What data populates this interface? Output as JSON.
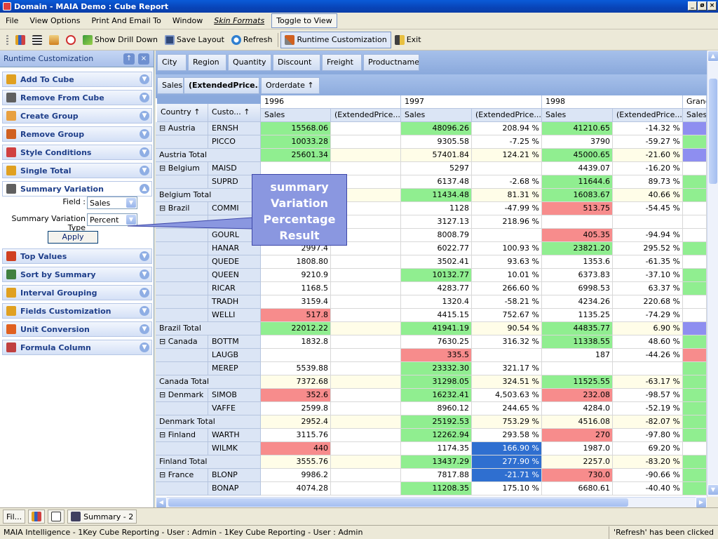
{
  "window": {
    "title": "Domain - MAIA Demo : Cube Report",
    "buttons": [
      "_",
      "ø",
      "×"
    ]
  },
  "menu": {
    "items": [
      "File",
      "View Options",
      "Print And Email To",
      "Window",
      "Skin Formats",
      "Toggle to View"
    ]
  },
  "toolbar": {
    "show_drill_down": "Show Drill Down",
    "save_layout": "Save Layout",
    "refresh": "Refresh",
    "runtime_customization": "Runtime Customization",
    "exit": "Exit"
  },
  "leftpanel": {
    "title": "Runtime Customization",
    "pin": "↑",
    "close": "×",
    "sections": [
      {
        "label": "Add To Cube",
        "icon": "add-cube-icon",
        "color": "#e0a020"
      },
      {
        "label": "Remove From Cube",
        "icon": "remove-cube-icon",
        "color": "#606060"
      },
      {
        "label": "Create Group",
        "icon": "create-group-icon",
        "color": "#e8a040"
      },
      {
        "label": "Remove Group",
        "icon": "remove-group-icon",
        "color": "#d06020"
      },
      {
        "label": "Style Conditions",
        "icon": "style-conditions-icon",
        "color": "#d04040"
      },
      {
        "label": "Single Total",
        "icon": "single-total-icon",
        "color": "#e0a020"
      },
      {
        "label": "Summary Variation",
        "icon": "summary-variation-icon",
        "color": "#606060"
      }
    ],
    "sections_after": [
      {
        "label": "Top Values",
        "icon": "top-values-icon",
        "color": "#d04020"
      },
      {
        "label": "Sort by Summary",
        "icon": "sort-summary-icon",
        "color": "#408040"
      },
      {
        "label": "Interval Grouping",
        "icon": "interval-grouping-icon",
        "color": "#e0a020"
      },
      {
        "label": "Fields Customization",
        "icon": "fields-customization-icon",
        "color": "#e0a020"
      },
      {
        "label": "Unit Conversion",
        "icon": "unit-conversion-icon",
        "color": "#e06020"
      },
      {
        "label": "Formula Column",
        "icon": "formula-column-icon",
        "color": "#c04040"
      }
    ],
    "summary_variation": {
      "field_label": "Field :",
      "field_value": "Sales",
      "type_label": "Summary Variation Type",
      "type_value": "Percent",
      "apply": "Apply"
    }
  },
  "grid": {
    "filter_fields": [
      "City",
      "Region",
      "Quantity",
      "Discount",
      "Freight",
      "Productname"
    ],
    "data_fields": [
      "Sales",
      "(ExtendedPrice..."
    ],
    "column_field": "Orderdate ↑",
    "years": [
      "1996",
      "1997",
      "1998",
      "Grand"
    ],
    "measures": [
      "Sales",
      "(ExtendedPrice...",
      "Sales",
      "(ExtendedPrice...",
      "Sales",
      "(ExtendedPrice...",
      "Sales"
    ],
    "row_fields": [
      "Country ↑",
      "Custo... ↑"
    ],
    "rows": [
      {
        "country": "⊟ Austria",
        "customer": "ERNSH",
        "v": [
          "15568.06",
          "",
          "48096.26",
          "208.94 %",
          "41210.65",
          "-14.32 %"
        ],
        "c": [
          "g",
          "",
          "g",
          "",
          "g",
          ""
        ],
        "gt": "p"
      },
      {
        "country": "",
        "customer": "PICCO",
        "v": [
          "10033.28",
          "",
          "9305.58",
          "-7.25 %",
          "3790",
          "-59.27 %"
        ],
        "c": [
          "g",
          "",
          "",
          "",
          "",
          ""
        ],
        "gt": "g"
      },
      {
        "total": "Austria Total",
        "v": [
          "25601.34",
          "",
          "57401.84",
          "124.21 %",
          "45000.65",
          "-21.60 %"
        ],
        "c": [
          "g",
          "",
          "",
          "",
          "g",
          ""
        ],
        "gt": "p"
      },
      {
        "country": "⊟ Belgium",
        "customer": "MAISD",
        "v": [
          "",
          "",
          "5297",
          "",
          "4439.07",
          "-16.20 %"
        ],
        "c": [
          "",
          "",
          "",
          "",
          "",
          ""
        ],
        "gt": ""
      },
      {
        "country": "",
        "customer": "SUPRD",
        "v": [
          "",
          "",
          "6137.48",
          "-2.68 %",
          "11644.6",
          "89.73 %"
        ],
        "c": [
          "",
          "",
          "",
          "",
          "g",
          ""
        ],
        "gt": "g"
      },
      {
        "total": "Belgium Total",
        "v": [
          "",
          "",
          "11434.48",
          "81.31 %",
          "16083.67",
          "40.66 %"
        ],
        "c": [
          "",
          "",
          "g",
          "",
          "g",
          ""
        ],
        "gt": "g"
      },
      {
        "country": "⊟ Brazil",
        "customer": "COMMI",
        "v": [
          "",
          "",
          "1128",
          "-47.99 %",
          "513.75",
          "-54.45 %"
        ],
        "c": [
          "",
          "",
          "",
          "",
          "r",
          ""
        ],
        "gt": ""
      },
      {
        "country": "",
        "customer": "",
        "v": [
          "",
          "",
          "3127.13",
          "218.96 %",
          "",
          ""
        ],
        "c": [
          "",
          "",
          "",
          "",
          "",
          ""
        ],
        "gt": ""
      },
      {
        "country": "",
        "customer": "GOURL",
        "v": [
          "",
          "",
          "8008.79",
          "",
          "405.35",
          "-94.94 %"
        ],
        "c": [
          "",
          "",
          "",
          "",
          "r",
          ""
        ],
        "gt": ""
      },
      {
        "country": "",
        "customer": "HANAR",
        "v": [
          "2997.4",
          "",
          "6022.77",
          "100.93 %",
          "23821.20",
          "295.52 %"
        ],
        "c": [
          "",
          "",
          "",
          "",
          "g",
          ""
        ],
        "gt": "g"
      },
      {
        "country": "",
        "customer": "QUEDE",
        "v": [
          "1808.80",
          "",
          "3502.41",
          "93.63 %",
          "1353.6",
          "-61.35 %"
        ],
        "c": [
          "",
          "",
          "",
          "",
          "",
          ""
        ],
        "gt": ""
      },
      {
        "country": "",
        "customer": "QUEEN",
        "v": [
          "9210.9",
          "",
          "10132.77",
          "10.01 %",
          "6373.83",
          "-37.10 %"
        ],
        "c": [
          "",
          "",
          "g",
          "",
          "",
          ""
        ],
        "gt": "g"
      },
      {
        "country": "",
        "customer": "RICAR",
        "v": [
          "1168.5",
          "",
          "4283.77",
          "266.60 %",
          "6998.53",
          "63.37 %"
        ],
        "c": [
          "",
          "",
          "",
          "",
          "",
          ""
        ],
        "gt": "g"
      },
      {
        "country": "",
        "customer": "TRADH",
        "v": [
          "3159.4",
          "",
          "1320.4",
          "-58.21 %",
          "4234.26",
          "220.68 %"
        ],
        "c": [
          "",
          "",
          "",
          "",
          "",
          ""
        ],
        "gt": ""
      },
      {
        "country": "",
        "customer": "WELLI",
        "v": [
          "517.8",
          "",
          "4415.15",
          "752.67 %",
          "1135.25",
          "-74.29 %"
        ],
        "c": [
          "r",
          "",
          "",
          "",
          "",
          ""
        ],
        "gt": ""
      },
      {
        "total": "Brazil Total",
        "v": [
          "22012.22",
          "",
          "41941.19",
          "90.54 %",
          "44835.77",
          "6.90 %"
        ],
        "c": [
          "g",
          "",
          "g",
          "",
          "g",
          ""
        ],
        "gt": "p"
      },
      {
        "country": "⊟ Canada",
        "customer": "BOTTM",
        "v": [
          "1832.8",
          "",
          "7630.25",
          "316.32 %",
          "11338.55",
          "48.60 %"
        ],
        "c": [
          "",
          "",
          "",
          "",
          "g",
          ""
        ],
        "gt": "g"
      },
      {
        "country": "",
        "customer": "LAUGB",
        "v": [
          "",
          "",
          "335.5",
          "",
          "187",
          "-44.26 %"
        ],
        "c": [
          "",
          "",
          "r",
          "",
          "",
          ""
        ],
        "gt": "r"
      },
      {
        "country": "",
        "customer": "MEREP",
        "v": [
          "5539.88",
          "",
          "23332.30",
          "321.17 %",
          "",
          ""
        ],
        "c": [
          "",
          "",
          "g",
          "",
          "",
          ""
        ],
        "gt": "g"
      },
      {
        "total": "Canada Total",
        "v": [
          "7372.68",
          "",
          "31298.05",
          "324.51 %",
          "11525.55",
          "-63.17 %"
        ],
        "c": [
          "",
          "",
          "g",
          "",
          "g",
          ""
        ],
        "gt": "g"
      },
      {
        "country": "⊟ Denmark",
        "customer": "SIMOB",
        "v": [
          "352.6",
          "",
          "16232.41",
          "4,503.63 %",
          "232.08",
          "-98.57 %"
        ],
        "c": [
          "r",
          "",
          "g",
          "",
          "r",
          ""
        ],
        "gt": "g"
      },
      {
        "country": "",
        "customer": "VAFFE",
        "v": [
          "2599.8",
          "",
          "8960.12",
          "244.65 %",
          "4284.0",
          "-52.19 %"
        ],
        "c": [
          "",
          "",
          "",
          "",
          "",
          ""
        ],
        "gt": "g"
      },
      {
        "total": "Denmark Total",
        "v": [
          "2952.4",
          "",
          "25192.53",
          "753.29 %",
          "4516.08",
          "-82.07 %"
        ],
        "c": [
          "",
          "",
          "g",
          "",
          "",
          ""
        ],
        "gt": "g"
      },
      {
        "country": "⊟ Finland",
        "customer": "WARTH",
        "v": [
          "3115.76",
          "",
          "12262.94",
          "293.58 %",
          "270",
          "-97.80 %"
        ],
        "c": [
          "",
          "",
          "g",
          "",
          "r",
          ""
        ],
        "gt": "g"
      },
      {
        "country": "",
        "customer": "WILMK",
        "v": [
          "440",
          "",
          "1174.35",
          "166.90 %",
          "1987.0",
          "69.20 %"
        ],
        "c": [
          "r",
          "",
          "",
          "b",
          "",
          ""
        ],
        "gt": ""
      },
      {
        "total": "Finland Total",
        "v": [
          "3555.76",
          "",
          "13437.29",
          "277.90 %",
          "2257.0",
          "-83.20 %"
        ],
        "c": [
          "",
          "",
          "g",
          "b",
          "",
          ""
        ],
        "gt": "g"
      },
      {
        "country": "⊟ France",
        "customer": "BLONP",
        "v": [
          "9986.2",
          "",
          "7817.88",
          "-21.71 %",
          "730.0",
          "-90.66 %"
        ],
        "c": [
          "",
          "",
          "",
          "b",
          "r",
          ""
        ],
        "gt": "g"
      },
      {
        "country": "",
        "customer": "BONAP",
        "v": [
          "4074.28",
          "",
          "11208.35",
          "175.10 %",
          "6680.61",
          "-40.40 %"
        ],
        "c": [
          "",
          "",
          "g",
          "",
          "",
          ""
        ],
        "gt": "g"
      }
    ]
  },
  "callout": {
    "text": "summary Variation Percentage Result"
  },
  "bottomtabs": {
    "fil": "Fil...",
    "summary": "Summary - 2"
  },
  "status": {
    "left": "MAIA Intelligence - 1Key Cube Reporting - User : Admin - 1Key Cube Reporting - User : Admin",
    "right": "'Refresh' has been clicked"
  },
  "colors": {
    "green": "#90ee90",
    "red": "#f78c8c",
    "purple": "#8e8ef0",
    "blue": "#2f6fd0",
    "total": "#fffde8"
  }
}
